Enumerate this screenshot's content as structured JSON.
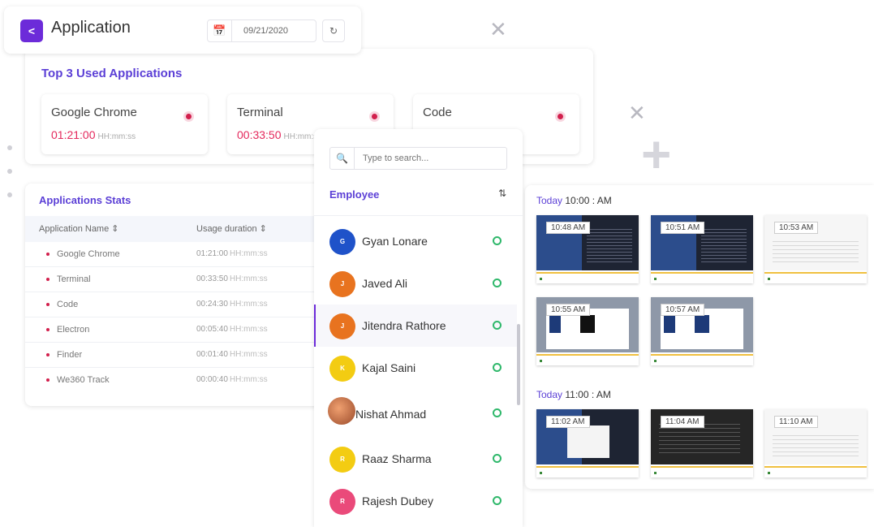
{
  "header": {
    "title": "Application",
    "back_icon": "chevron-left-icon",
    "date": "09/21/2020",
    "calendar_icon": "calendar-icon",
    "refresh_icon": "refresh-icon"
  },
  "top_apps": {
    "title": "Top 3 Used Applications",
    "items": [
      {
        "name": "Google Chrome",
        "duration": "01:21:00",
        "unit": "HH:mm:ss"
      },
      {
        "name": "Terminal",
        "duration": "00:33:50",
        "unit": "HH:mm:ss"
      },
      {
        "name": "Code",
        "duration": "",
        "unit": ""
      }
    ]
  },
  "stats": {
    "title": "Applications Stats",
    "columns": [
      "Application Name ⇕",
      "Usage duration ⇕"
    ],
    "rows": [
      {
        "name": "Google Chrome",
        "duration": "01:21:00",
        "unit": "HH:mm:ss"
      },
      {
        "name": "Terminal",
        "duration": "00:33:50",
        "unit": "HH:mm:ss"
      },
      {
        "name": "Code",
        "duration": "00:24:30",
        "unit": "HH:mm:ss"
      },
      {
        "name": "Electron",
        "duration": "00:05:40",
        "unit": "HH:mm:ss"
      },
      {
        "name": "Finder",
        "duration": "00:01:40",
        "unit": "HH:mm:ss"
      },
      {
        "name": "We360 Track",
        "duration": "00:00:40",
        "unit": "HH:mm:ss"
      }
    ]
  },
  "employees": {
    "search_placeholder": "Type to search...",
    "label": "Employee",
    "sort_icon": "sort-icon",
    "list": [
      {
        "name": "Gyan Lonare",
        "initial": "G",
        "color": "#1f52c9",
        "active": false
      },
      {
        "name": "Javed Ali",
        "initial": "J",
        "color": "#e8731f",
        "active": false
      },
      {
        "name": "Jitendra Rathore",
        "initial": "J",
        "color": "#e8731f",
        "active": true
      },
      {
        "name": "Kajal Saini",
        "initial": "K",
        "color": "#f3cc12",
        "active": false
      },
      {
        "name": "Nishat Ahmad",
        "initial": "",
        "color": "#c86a3a",
        "active": false
      },
      {
        "name": "Raaz Sharma",
        "initial": "R",
        "color": "#f3cc12",
        "active": false
      },
      {
        "name": "Rajesh Dubey",
        "initial": "R",
        "color": "#ea4a7a",
        "active": false
      }
    ]
  },
  "screenshots": {
    "groups": [
      {
        "today": "Today",
        "time": "10:00 : AM",
        "times": [
          "10:48 AM",
          "10:51 AM",
          "10:53 AM",
          "10:55 AM",
          "10:57 AM"
        ]
      },
      {
        "today": "Today",
        "time": "11:00 : AM",
        "times": [
          "11:02 AM",
          "11:04 AM",
          "11:10 AM"
        ]
      }
    ]
  },
  "colors": {
    "accent": "#6c2bd9",
    "title_purple": "#5b3fd6",
    "duration_red": "#e4285c",
    "online_green": "#2fb86b"
  }
}
